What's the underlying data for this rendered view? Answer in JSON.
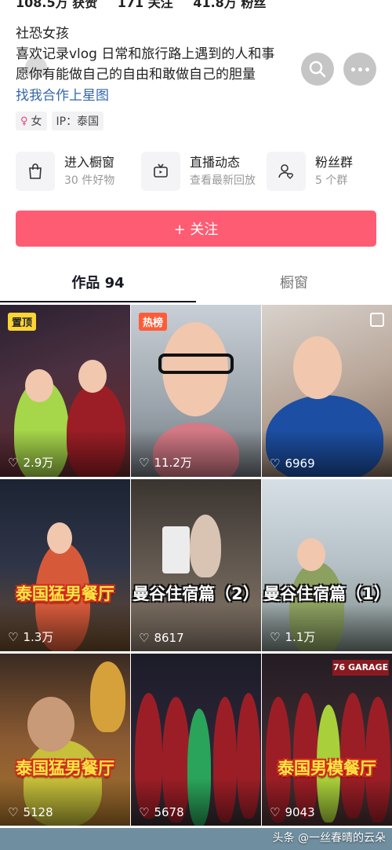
{
  "top_stats": [
    "108.5万 获赞",
    "171 关注",
    "41.8万 粉丝"
  ],
  "profile": {
    "line1": "社恐女孩",
    "line2": "喜欢记录vlog 日常和旅行路上遇到的人和事",
    "line3": "愿你有能做自己的自由和敢做自己的胆量",
    "link": "找我合作上星图",
    "gender_tag": "女",
    "ip_tag": "IP：泰国"
  },
  "services": [
    {
      "title": "进入橱窗",
      "sub": "30 件好物",
      "icon": "shopping-bag-icon"
    },
    {
      "title": "直播动态",
      "sub": "查看最新回放",
      "icon": "tv-icon"
    },
    {
      "title": "粉丝群",
      "sub": "5 个群",
      "icon": "fan-group-icon"
    }
  ],
  "follow_button": "+ 关注",
  "tabs": [
    {
      "label": "作品 94",
      "active": true
    },
    {
      "label": "橱窗",
      "active": false
    }
  ],
  "videos": [
    {
      "likes": "2.9万",
      "badge": "置顶",
      "caption": ""
    },
    {
      "likes": "11.2万",
      "badge": "热榜",
      "caption": ""
    },
    {
      "likes": "6969",
      "badge": "",
      "caption": ""
    },
    {
      "likes": "1.3万",
      "badge": "",
      "caption": "泰国猛男餐厅"
    },
    {
      "likes": "8617",
      "badge": "",
      "caption": "曼谷住宿篇（2）"
    },
    {
      "likes": "1.1万",
      "badge": "",
      "caption": "曼谷住宿篇（1）"
    },
    {
      "likes": "5128",
      "badge": "",
      "caption": "泰国猛男餐厅"
    },
    {
      "likes": "5678",
      "badge": "",
      "caption": ""
    },
    {
      "likes": "9043",
      "badge": "",
      "caption": "泰国男模餐厅"
    }
  ],
  "watermark": "头条 @一丝春晴的云朵",
  "colors": {
    "follow": "#fe5c73",
    "link": "#3366aa",
    "pin_badge": "#fcd535",
    "hot_badge": "#fe5c38"
  }
}
